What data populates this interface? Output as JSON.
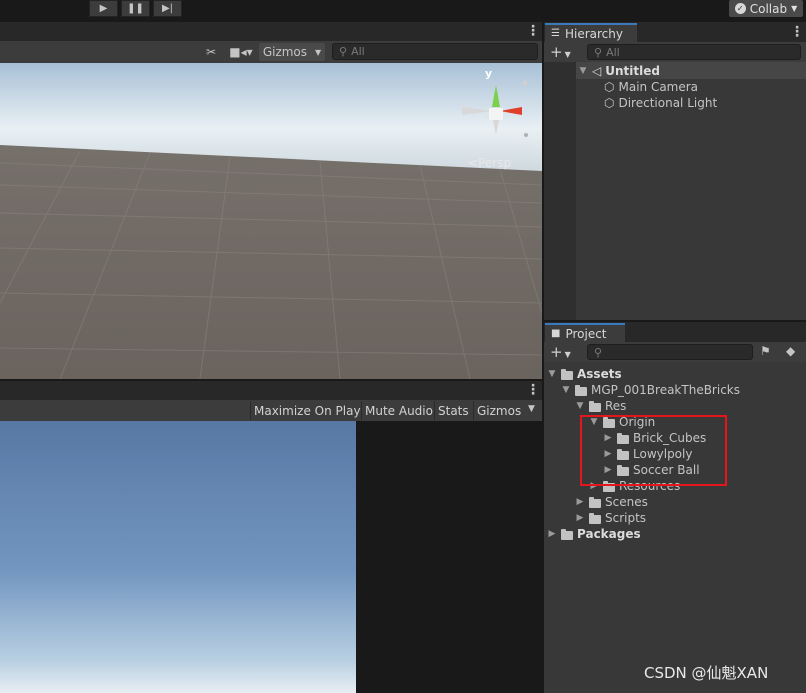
{
  "toolbar": {
    "play_icon": "play-icon",
    "pause_icon": "pause-icon",
    "step_icon": "step-icon",
    "collab_label": "Collab"
  },
  "scene": {
    "gizmos_label": "Gizmos",
    "search_placeholder": "All",
    "persp_label": "Persp",
    "axis_y_label": "y"
  },
  "game": {
    "buttons": [
      "Maximize On Play",
      "Mute Audio",
      "Stats",
      "Gizmos"
    ]
  },
  "hierarchy": {
    "tab_label": "Hierarchy",
    "search_placeholder": "All",
    "scene_name": "Untitled",
    "items": [
      "Main Camera",
      "Directional Light"
    ]
  },
  "project": {
    "tab_label": "Project",
    "search_placeholder": "",
    "tree": {
      "assets": "Assets",
      "project_folder": "MGP_001BreakTheBricks",
      "res": "Res",
      "origin": "Origin",
      "origin_children": [
        "Brick_Cubes",
        "Lowylpoly",
        "Soccer Ball"
      ],
      "resources": "Resources",
      "scenes": "Scenes",
      "scripts": "Scripts",
      "packages": "Packages"
    }
  },
  "watermark": "CSDN @仙魁XAN",
  "colors": {
    "accent": "#3a79bb",
    "highlight": "#e4151b"
  }
}
